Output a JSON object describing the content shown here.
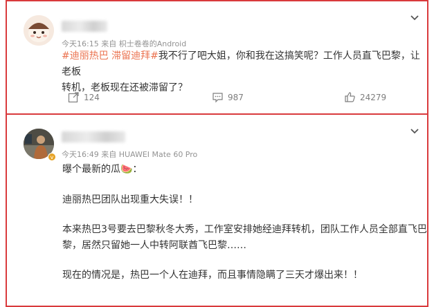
{
  "post1": {
    "meta": "今天16:15  来自 枳士卷卷的Android",
    "tags": "#迪丽热巴 滞留迪拜#",
    "text_line1": "我不行了吧大姐，你和我在这搞笑呢？工作人员直飞巴黎，让老板",
    "text_line2": "转机，老板现在还被滞留了？",
    "repost_count": "124",
    "comment_count": "987",
    "like_count": "24279"
  },
  "post2": {
    "meta": "今天16:49  来自 HUAWEI Mate 60 Pro",
    "line1": "曝个最新的瓜🍉：",
    "line2": "迪丽热巴团队出现重大失误！！",
    "line3": "本来热巴3号要去巴黎秋冬大秀，工作室安排她经迪拜转机，团队工作人员全部直飞巴",
    "line4": "黎，居然只留她一人中转阿联酋飞巴黎……",
    "line5": "现在的情况是，热巴一个人在迪拜，而且事情隐瞒了三天才爆出来！！"
  },
  "colors": {
    "frame_red": "#d9393c",
    "tag_orange": "#eb7350",
    "meta_gray": "#939393"
  },
  "icons": [
    "chevron-down-icon",
    "repost-icon",
    "comment-icon",
    "like-icon",
    "verified-badge-icon"
  ]
}
